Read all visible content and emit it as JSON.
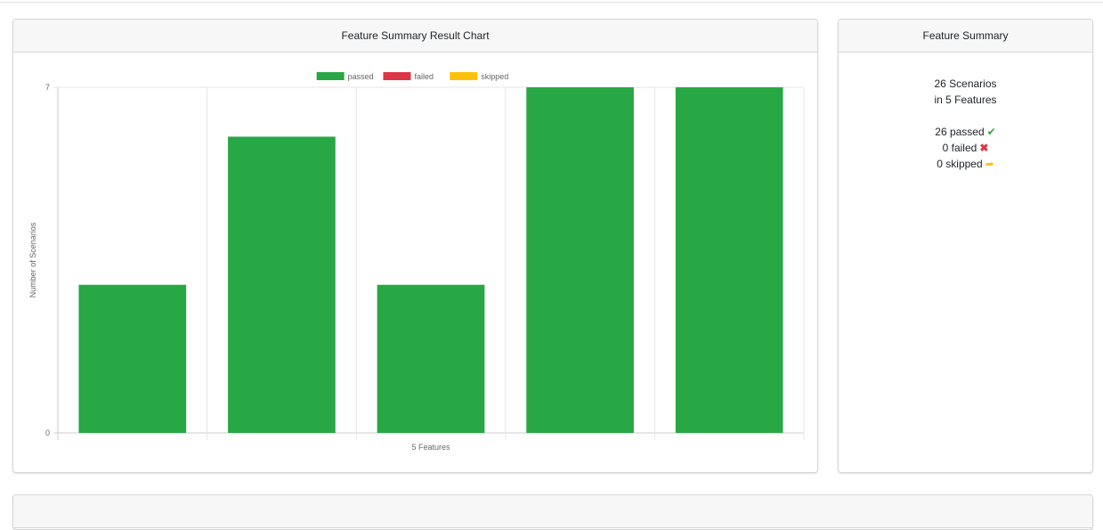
{
  "chart_card": {
    "title": "Feature Summary Result Chart"
  },
  "summary_card": {
    "title": "Feature Summary",
    "scenarios_line": "26 Scenarios",
    "features_line": "in 5 Features",
    "passed_text": "26 passed",
    "failed_text": "0 failed",
    "skipped_text": "0 skipped",
    "icons": {
      "passed": "check-icon",
      "failed": "cross-icon",
      "skipped": "forward-arrow-icon"
    }
  },
  "colors": {
    "passed": "#28a745",
    "failed": "#dc3545",
    "skipped": "#ffc107"
  },
  "chart_data": {
    "type": "bar",
    "stacked": true,
    "categories": [
      "",
      "",
      "",
      "",
      ""
    ],
    "series": [
      {
        "name": "passed",
        "values": [
          3,
          6,
          3,
          7,
          7
        ],
        "color": "#28a745"
      },
      {
        "name": "failed",
        "values": [
          0,
          0,
          0,
          0,
          0
        ],
        "color": "#dc3545"
      },
      {
        "name": "skipped",
        "values": [
          0,
          0,
          0,
          0,
          0
        ],
        "color": "#ffc107"
      }
    ],
    "title": "",
    "xlabel": "5 Features",
    "ylabel": "Number of Scenarios",
    "ylim": [
      0,
      7
    ],
    "yticks": [
      "0",
      "7"
    ],
    "grid": true,
    "legend": "top"
  }
}
